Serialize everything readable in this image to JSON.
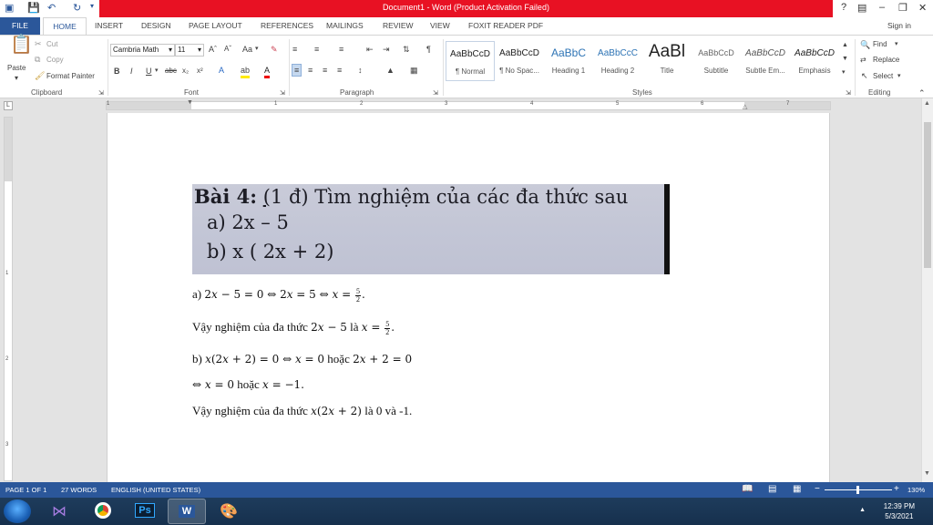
{
  "window": {
    "title": "Document1 - Word (Product Activation Failed)",
    "help": "?",
    "sign_in": "Sign in"
  },
  "tabs": [
    "FILE",
    "HOME",
    "INSERT",
    "DESIGN",
    "PAGE LAYOUT",
    "REFERENCES",
    "MAILINGS",
    "REVIEW",
    "VIEW",
    "FOXIT READER PDF"
  ],
  "ribbon": {
    "clipboard": {
      "label": "Clipboard",
      "paste": "Paste",
      "cut": "Cut",
      "copy": "Copy",
      "format_painter": "Format Painter"
    },
    "font": {
      "label": "Font",
      "name": "Cambria Math",
      "size": "11",
      "case": "Aa",
      "bold": "B",
      "italic": "I",
      "underline": "U",
      "strike": "abc",
      "sub": "x₂",
      "sup": "x²"
    },
    "paragraph": {
      "label": "Paragraph",
      "pilcrow": "¶"
    },
    "styles": {
      "label": "Styles",
      "items": [
        {
          "sample": "AaBbCcD",
          "name": "¶ Normal"
        },
        {
          "sample": "AaBbCcD",
          "name": "¶ No Spac..."
        },
        {
          "sample": "AaBbC",
          "name": "Heading 1"
        },
        {
          "sample": "AaBbCcC",
          "name": "Heading 2"
        },
        {
          "sample": "AaBl",
          "name": "Title"
        },
        {
          "sample": "AaBbCcD",
          "name": "Subtitle"
        },
        {
          "sample": "AaBbCcD",
          "name": "Subtle Em..."
        },
        {
          "sample": "AaBbCcD",
          "name": "Emphasis"
        }
      ]
    },
    "editing": {
      "label": "Editing",
      "find": "Find",
      "replace": "Replace",
      "select": "Select"
    }
  },
  "ruler": {
    "numbers": [
      "1",
      "1",
      "2",
      "3",
      "4",
      "5",
      "6",
      "7"
    ],
    "vnumbers": [
      "1",
      "2",
      "3"
    ]
  },
  "document": {
    "image_lines": {
      "l1_bold": "Bài 4:",
      "l1_u": "(",
      "l1_rest": "1 đ) Tìm nghiệm của các đa thức sau",
      "l2": "a)  2x – 5",
      "l3": "b)   x ( 2x + 2)"
    },
    "lines": {
      "p1_prefix": "a) ",
      "p1_math": "2𝑥 − 5 = 0 ⇔ 2𝑥 = 5 ⇔ 𝑥 = ",
      "p1_num": "5",
      "p1_den": "2",
      "p1_end": ".",
      "p2_text": "Vậy nghiệm của đa thức ",
      "p2_math": "2𝑥 − 5",
      "p2_text2": " là ",
      "p2_math2": "𝑥 = ",
      "p2_num": "5",
      "p2_den": "2",
      "p2_end": ".",
      "p3_prefix": "b) ",
      "p3_math1": "𝑥(2𝑥 + 2) = 0 ⇔ 𝑥 = 0",
      "p3_text": " hoặc ",
      "p3_math2": "2𝑥 + 2 = 0",
      "p4_math1": "⇔ 𝑥 = 0",
      "p4_text": " hoặc ",
      "p4_math2": "𝑥 = −1.",
      "p5_text": "Vậy nghiệm của đa thức ",
      "p5_math": "𝑥(2𝑥 + 2)",
      "p5_text2": " là 0 và -1."
    }
  },
  "status": {
    "page": "PAGE 1 OF 1",
    "words": "27 WORDS",
    "lang": "ENGLISH (UNITED STATES)",
    "zoom": "130%",
    "minus": "−",
    "plus": "+"
  },
  "taskbar": {
    "ps": "Ps",
    "word": "W",
    "time": "12:39 PM",
    "date": "5/3/2021"
  },
  "colors": {
    "accent": "#2b579a",
    "title_alert": "#e81123"
  }
}
